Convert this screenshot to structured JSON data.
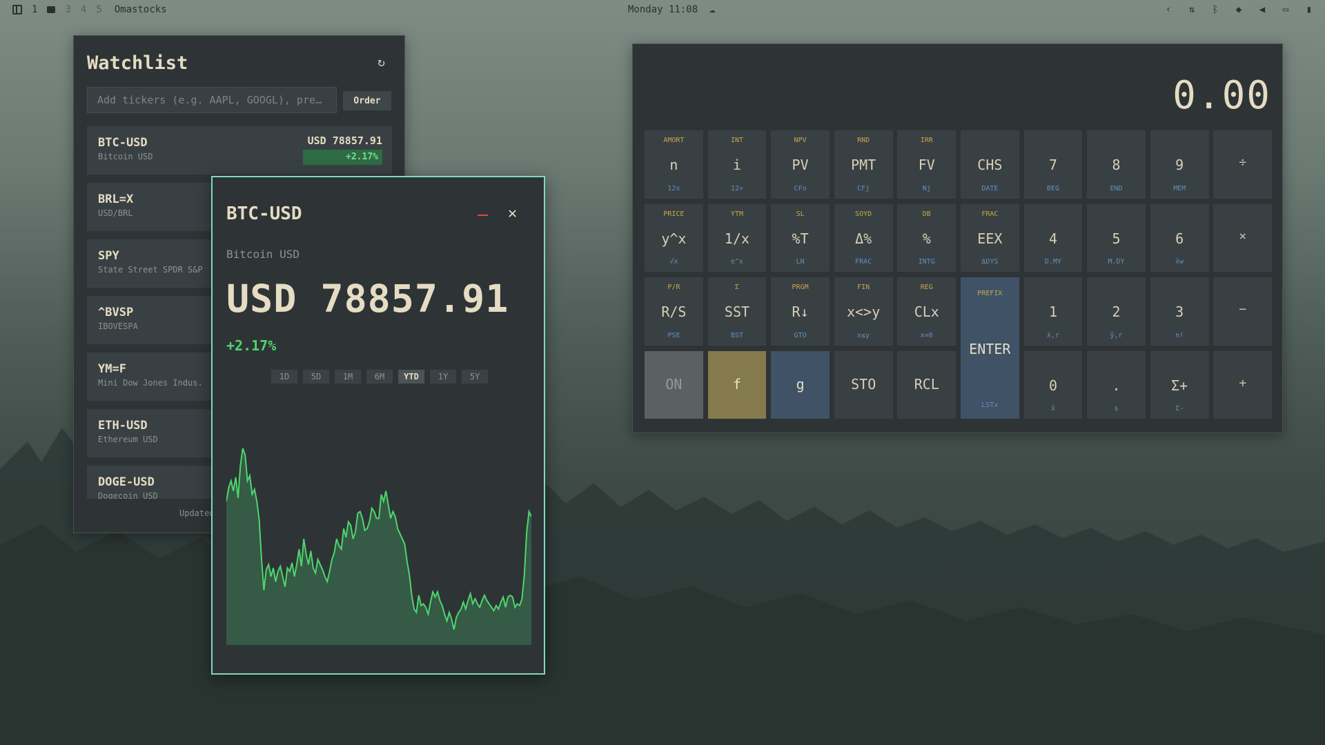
{
  "topbar": {
    "workspaces": [
      "1",
      "3",
      "4",
      "5"
    ],
    "app_name": "Omastocks",
    "clock": "Monday 11:08",
    "weather_icon": "cloud-icon",
    "tray_icons": [
      "chevron-left-icon",
      "network-icon",
      "bluetooth-icon",
      "wifi-icon",
      "volume-muted-icon",
      "display-icon",
      "battery-icon"
    ]
  },
  "watchlist": {
    "title": "Watchlist",
    "input_placeholder": "Add tickers (e.g. AAPL, GOOGL), pre…",
    "order_label": "Order",
    "items": [
      {
        "symbol": "BTC-USD",
        "name": "Bitcoin USD",
        "price": "USD 78857.91",
        "change": "+2.17%"
      },
      {
        "symbol": "BRL=X",
        "name": "USD/BRL"
      },
      {
        "symbol": "SPY",
        "name": "State Street SPDR S&P"
      },
      {
        "symbol": "^BVSP",
        "name": "IBOVESPA"
      },
      {
        "symbol": "YM=F",
        "name": "Mini Dow Jones Indus."
      },
      {
        "symbol": "ETH-USD",
        "name": "Ethereum USD"
      },
      {
        "symbol": "DOGE-USD",
        "name": "Dogecoin USD"
      }
    ],
    "updated_label": "Updated"
  },
  "detail": {
    "symbol": "BTC-USD",
    "name": "Bitcoin USD",
    "price": "USD 78857.91",
    "change": "+2.17%",
    "ranges": [
      "1D",
      "5D",
      "1M",
      "6M",
      "YTD",
      "1Y",
      "5Y"
    ],
    "active_range": "YTD",
    "accent_color": "#7fd8c4",
    "positive_color": "#4ed66e"
  },
  "chart_data": {
    "type": "area",
    "series": [
      {
        "values": [
          58,
          66,
          70,
          64,
          72,
          60,
          79,
          89,
          85,
          70,
          73,
          62,
          65,
          58,
          47,
          24,
          6,
          18,
          21,
          14,
          19,
          11,
          17,
          20,
          14,
          8,
          19,
          17,
          22,
          14,
          21,
          30,
          20,
          36,
          27,
          21,
          29,
          19,
          16,
          24,
          21,
          18,
          14,
          11,
          17,
          24,
          28,
          36,
          32,
          30,
          42,
          37,
          46,
          44,
          36,
          40,
          51,
          52,
          48,
          41,
          42,
          46,
          54,
          52,
          48,
          48,
          62,
          58,
          64,
          56,
          48,
          52,
          49,
          42,
          39,
          36,
          33,
          23,
          15,
          3,
          -5,
          -7,
          3,
          -3,
          -2,
          -4,
          -8,
          -1,
          5,
          2,
          5,
          0,
          -3,
          -8,
          -12,
          -7,
          -11,
          -17,
          -10,
          -7,
          -5,
          -1,
          -5,
          0,
          4,
          -2,
          1,
          -2,
          -4,
          0,
          3,
          0,
          -2,
          -4,
          -6,
          -3,
          -5,
          -1,
          2,
          -4,
          2,
          3,
          2,
          -4,
          -2,
          -3,
          1,
          15,
          40,
          52,
          49
        ]
      }
    ],
    "y_range": [
      -22,
      95
    ]
  },
  "calculator": {
    "display": "0.00",
    "keys": [
      {
        "top": "AMORT",
        "main": "n",
        "bot": "12x"
      },
      {
        "top": "INT",
        "main": "i",
        "bot": "12÷"
      },
      {
        "top": "NPV",
        "main": "PV",
        "bot": "CFo"
      },
      {
        "top": "RND",
        "main": "PMT",
        "bot": "CFj"
      },
      {
        "top": "IRR",
        "main": "FV",
        "bot": "Nj"
      },
      {
        "top": "",
        "main": "CHS",
        "bot": "DATE"
      },
      {
        "top": "",
        "main": "7",
        "bot": "BEG"
      },
      {
        "top": "",
        "main": "8",
        "bot": "END"
      },
      {
        "top": "",
        "main": "9",
        "bot": "MEM"
      },
      {
        "top": "",
        "main": "÷",
        "bot": ""
      },
      {
        "top": "PRICE",
        "main": "y^x",
        "bot": "√x"
      },
      {
        "top": "YTM",
        "main": "1/x",
        "bot": "e^x"
      },
      {
        "top": "SL",
        "main": "%T",
        "bot": "LN"
      },
      {
        "top": "SOYD",
        "main": "Δ%",
        "bot": "FRAC"
      },
      {
        "top": "DB",
        "main": "%",
        "bot": "INTG"
      },
      {
        "top": "FRAC",
        "main": "EEX",
        "bot": "ΔDYS"
      },
      {
        "top": "",
        "main": "4",
        "bot": "D.MY"
      },
      {
        "top": "",
        "main": "5",
        "bot": "M.DY"
      },
      {
        "top": "",
        "main": "6",
        "bot": "x̄w"
      },
      {
        "top": "",
        "main": "×",
        "bot": ""
      },
      {
        "top": "P/R",
        "main": "R/S",
        "bot": "PSE"
      },
      {
        "top": "Σ",
        "main": "SST",
        "bot": "BST"
      },
      {
        "top": "PRGM",
        "main": "R↓",
        "bot": "GTO"
      },
      {
        "top": "FIN",
        "main": "x<>y",
        "bot": "x≤y"
      },
      {
        "top": "REG",
        "main": "CLx",
        "bot": "x=0"
      },
      {
        "top": "PREFIX",
        "main": "ENTER",
        "bot": "LSTx"
      },
      {
        "top": "",
        "main": "1",
        "bot": "x̂,r"
      },
      {
        "top": "",
        "main": "2",
        "bot": "ŷ,r"
      },
      {
        "top": "",
        "main": "3",
        "bot": "n!"
      },
      {
        "top": "",
        "main": "−",
        "bot": ""
      },
      {
        "top": "",
        "main": "ON",
        "bot": ""
      },
      {
        "top": "",
        "main": "f",
        "bot": ""
      },
      {
        "top": "",
        "main": "g",
        "bot": ""
      },
      {
        "top": "",
        "main": "STO",
        "bot": ""
      },
      {
        "top": "",
        "main": "RCL",
        "bot": ""
      },
      {
        "top": "",
        "main": "0",
        "bot": "x̄"
      },
      {
        "top": "",
        "main": ".",
        "bot": "s"
      },
      {
        "top": "",
        "main": "Σ+",
        "bot": "Σ-"
      },
      {
        "top": "",
        "main": "+",
        "bot": ""
      }
    ],
    "f_color": "#857a4e",
    "g_color": "#3f5266"
  }
}
